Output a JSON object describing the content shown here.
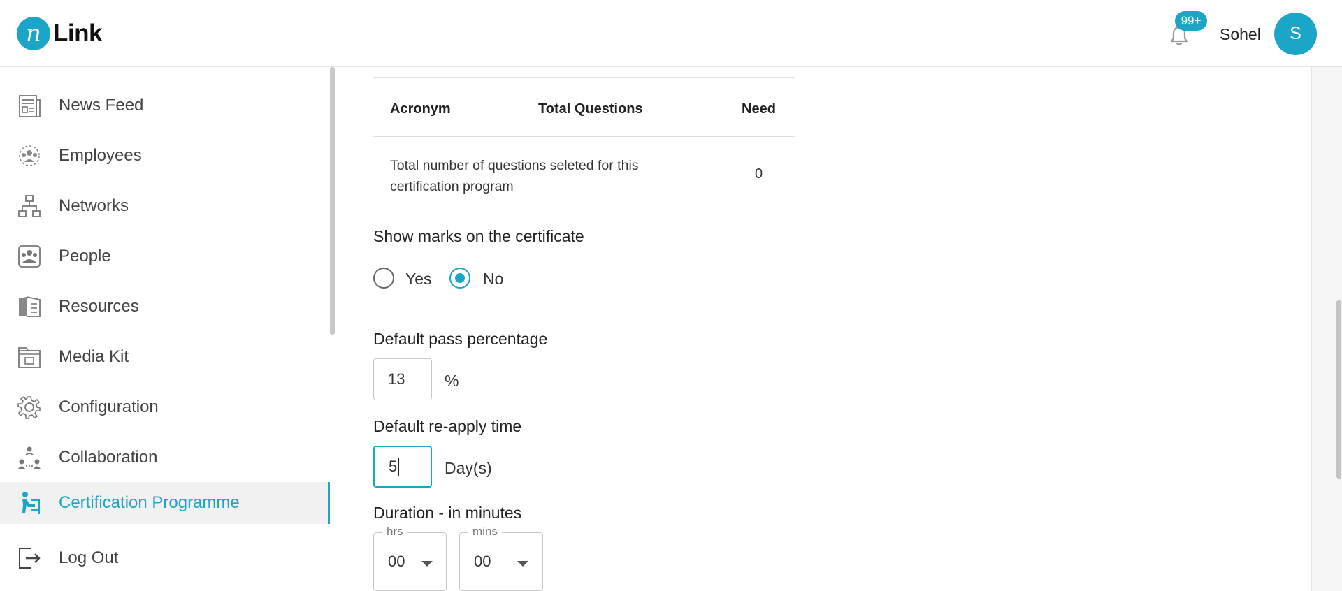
{
  "app": {
    "logo_letter": "n",
    "logo_text": "Link",
    "notification_count": "99+",
    "user_name": "Sohel",
    "user_initial": "S",
    "accent_color": "#1ba5c7"
  },
  "sidebar": {
    "items": [
      {
        "label": "News Feed",
        "icon": "news-feed-icon"
      },
      {
        "label": "Employees",
        "icon": "employees-icon"
      },
      {
        "label": "Networks",
        "icon": "networks-icon"
      },
      {
        "label": "People",
        "icon": "people-icon"
      },
      {
        "label": "Resources",
        "icon": "resources-icon"
      },
      {
        "label": "Media Kit",
        "icon": "media-kit-icon"
      },
      {
        "label": "Configuration",
        "icon": "gear-icon"
      },
      {
        "label": "Collaboration",
        "icon": "collaboration-icon"
      },
      {
        "label": "Certification Programme",
        "icon": "certification-icon",
        "active": true
      },
      {
        "label": "Log Out",
        "icon": "logout-icon"
      }
    ]
  },
  "table": {
    "headers": [
      "Acronym",
      "Total Questions",
      "Need"
    ],
    "row_text": "Total number of questions seleted for this certification program",
    "row_value": "0"
  },
  "form": {
    "show_marks_label": "Show marks on the certificate",
    "yes_label": "Yes",
    "no_label": "No",
    "show_marks_selected": "No",
    "pass_percentage_label": "Default pass percentage",
    "pass_percentage_value": "13",
    "pass_percentage_unit": "%",
    "reapply_label": "Default re-apply time",
    "reapply_value": "5",
    "reapply_unit": "Day(s)",
    "duration_label": "Duration - in minutes",
    "hrs_legend": "hrs",
    "hrs_value": "00",
    "mins_legend": "mins",
    "mins_value": "00"
  }
}
